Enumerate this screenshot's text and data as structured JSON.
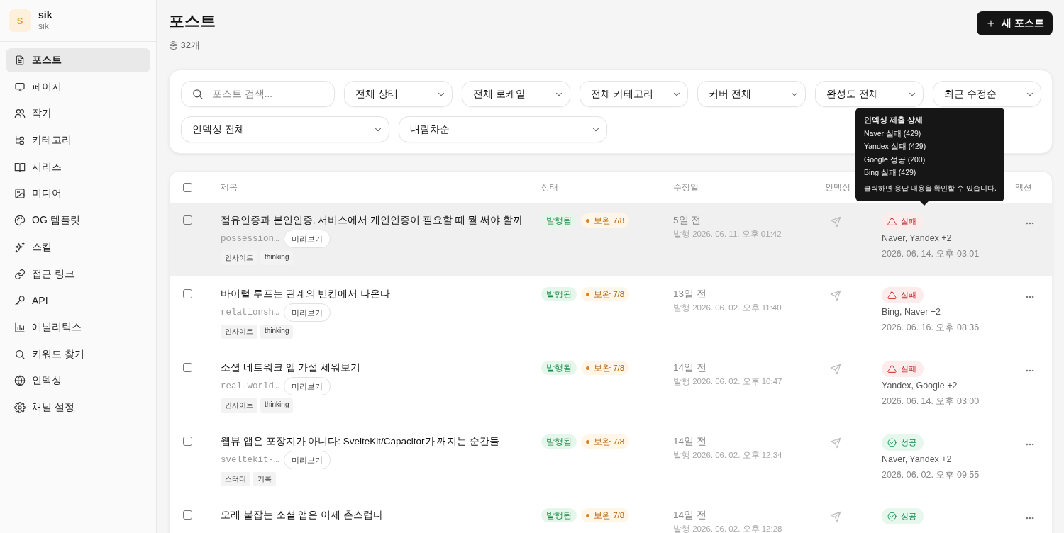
{
  "account": {
    "initial": "S",
    "name": "sik",
    "handle": "sik"
  },
  "sidebar": {
    "items": [
      {
        "label": "포스트",
        "selected": true
      },
      {
        "label": "페이지",
        "selected": false
      },
      {
        "label": "작가",
        "selected": false
      },
      {
        "label": "카테고리",
        "selected": false
      },
      {
        "label": "시리즈",
        "selected": false
      },
      {
        "label": "미디어",
        "selected": false
      },
      {
        "label": "OG 템플릿",
        "selected": false
      },
      {
        "label": "스킬",
        "selected": false
      },
      {
        "label": "접근 링크",
        "selected": false
      },
      {
        "label": "API",
        "selected": false
      },
      {
        "label": "애널리틱스",
        "selected": false
      },
      {
        "label": "키워드 찾기",
        "selected": false
      },
      {
        "label": "인덱싱",
        "selected": false
      },
      {
        "label": "채널 설정",
        "selected": false
      }
    ]
  },
  "page": {
    "title": "포스트",
    "count": "총 32개",
    "new_button": "새 포스트"
  },
  "filters": {
    "search_placeholder": "포스트 검색...",
    "selects": [
      "전체 상태",
      "전체 로케일",
      "전체 카테고리",
      "커버 전체",
      "완성도 전체",
      "최근 수정순",
      "인덱싱 전체",
      "내림차순"
    ]
  },
  "table": {
    "select_all_checked": false,
    "columns": [
      "제목",
      "상태",
      "수정일",
      "인덱싱",
      "액션"
    ],
    "rows": [
      {
        "checked": false,
        "highlighted": true,
        "title": "점유인증과 본인인증, 서비스에서 개인인증이 필요할 때 뭘 써야 할까",
        "slug": "possession…",
        "preview": "미리보기",
        "tags": [
          "인사이트",
          "thinking"
        ],
        "status": {
          "kind": "published",
          "label": "발행됨"
        },
        "completeness": "보완 7/8",
        "modified": "5일 전",
        "published": "발행 2026. 06. 11. 오후 01:42",
        "index_result": {
          "kind": "failure",
          "label": "실패"
        },
        "engines": "Naver, Yandex +2",
        "indexed_at": "2026. 06. 14. 오후 03:01"
      },
      {
        "checked": false,
        "highlighted": false,
        "title": "바이럴 루프는 관계의 빈칸에서 나온다",
        "slug": "relationsh…",
        "preview": "미리보기",
        "tags": [
          "인사이트",
          "thinking"
        ],
        "status": {
          "kind": "published",
          "label": "발행됨"
        },
        "completeness": "보완 7/8",
        "modified": "13일 전",
        "published": "발행 2026. 06. 02. 오후 11:40",
        "index_result": {
          "kind": "failure",
          "label": "실패"
        },
        "engines": "Bing, Naver +2",
        "indexed_at": "2026. 06. 16. 오후 08:36"
      },
      {
        "checked": false,
        "highlighted": false,
        "title": "소셜 네트워크 앱 가설 세워보기",
        "slug": "real-world…",
        "preview": "미리보기",
        "tags": [
          "인사이트",
          "thinking"
        ],
        "status": {
          "kind": "published",
          "label": "발행됨"
        },
        "completeness": "보완 7/8",
        "modified": "14일 전",
        "published": "발행 2026. 06. 02. 오후 10:47",
        "index_result": {
          "kind": "failure",
          "label": "실패"
        },
        "engines": "Yandex, Google +2",
        "indexed_at": "2026. 06. 14. 오후 03:00"
      },
      {
        "checked": false,
        "highlighted": false,
        "title": "웹뷰 앱은 포장지가 아니다: SvelteKit/Capacitor가 깨지는 순간들",
        "slug": "sveltekit-…",
        "preview": "미리보기",
        "tags": [
          "스터디",
          "기록"
        ],
        "status": {
          "kind": "published",
          "label": "발행됨"
        },
        "completeness": "보완 7/8",
        "modified": "14일 전",
        "published": "발행 2026. 06. 02. 오후 12:34",
        "index_result": {
          "kind": "success",
          "label": "성공"
        },
        "engines": "Naver, Yandex +2",
        "indexed_at": "2026. 06. 02. 오후 09:55"
      },
      {
        "checked": false,
        "highlighted": false,
        "title": "오래 붙잡는 소셜 앱은 이제 촌스럽다",
        "status": {
          "kind": "published",
          "label": "발행됨"
        },
        "completeness": "보완 7/8",
        "modified": "14일 전",
        "published": "발행 2026. 06. 02. 오후 12:28",
        "index_result": {
          "kind": "success",
          "label": "성공"
        }
      }
    ]
  },
  "tooltip": {
    "title": "인덱싱 제출 상세",
    "lines": [
      "Naver 실패 (429)",
      "Yandex 실패 (429)",
      "Google 성공 (200)",
      "Bing 실패 (429)"
    ],
    "note": "클릭하면 응답 내용을 확인할 수 있습니다."
  }
}
